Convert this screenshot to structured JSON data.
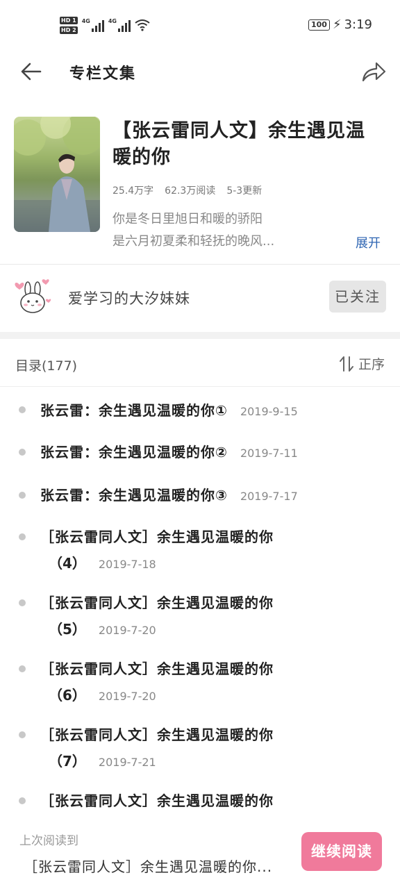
{
  "status_bar": {
    "hd1": "HD 1",
    "hd2": "HD 2",
    "net1": "4G",
    "net2": "4G",
    "battery": "100",
    "time": "3:19"
  },
  "header": {
    "title": "专栏文集"
  },
  "book": {
    "title": "【张云雷同人文】余生遇见温暖的你",
    "word_count": "25.4万字",
    "reads": "62.3万阅读",
    "updated": "5-3更新",
    "desc_line1": "你是冬日里旭日和暖的骄阳",
    "desc_line2": "是六月初夏柔和轻抚的晚风...",
    "expand_label": "展开"
  },
  "author": {
    "name": "爱学习的大汐妹妹",
    "follow_label": "已关注"
  },
  "toc": {
    "label": "目录(177)",
    "sort_label": "正序",
    "items": [
      {
        "line1": "张云雷：余生遇见温暖的你①",
        "line2": "",
        "date": "2019-9-15"
      },
      {
        "line1": "张云雷：余生遇见温暖的你②",
        "line2": "",
        "date": "2019-7-11"
      },
      {
        "line1": "张云雷：余生遇见温暖的你③",
        "line2": "",
        "date": "2019-7-17"
      },
      {
        "line1": "［张云雷同人文］余生遇见温暖的你",
        "line2": "（4）",
        "date": "2019-7-18"
      },
      {
        "line1": "［张云雷同人文］余生遇见温暖的你",
        "line2": "（5）",
        "date": "2019-7-20"
      },
      {
        "line1": "［张云雷同人文］余生遇见温暖的你",
        "line2": "（6）",
        "date": "2019-7-20"
      },
      {
        "line1": "［张云雷同人文］余生遇见温暖的你",
        "line2": "（7）",
        "date": "2019-7-21"
      },
      {
        "line1": "［张云雷同人文］余生遇见温暖的你",
        "line2": "",
        "date": ""
      }
    ]
  },
  "bottom": {
    "last_read_label": "上次阅读到",
    "last_read_title": "［张云雷同人文］余生遇见温暖的你...",
    "continue_label": "继续阅读"
  },
  "colors": {
    "accent_pink": "#f07a9b",
    "link_blue": "#2f66b3"
  }
}
